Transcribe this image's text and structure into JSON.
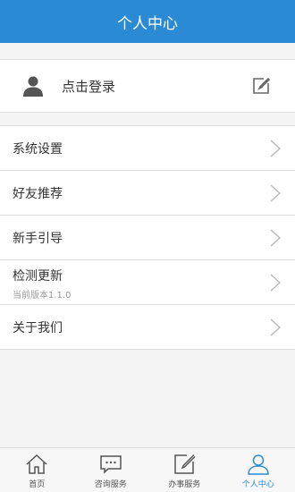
{
  "header": {
    "title": "个人中心"
  },
  "login": {
    "label": "点击登录",
    "icon": "user-icon",
    "edit_icon": "edit-icon"
  },
  "menu": [
    {
      "label": "系统设置",
      "sub": ""
    },
    {
      "label": "好友推荐",
      "sub": ""
    },
    {
      "label": "新手引导",
      "sub": ""
    },
    {
      "label": "检测更新",
      "sub": "当前版本1.1.0"
    },
    {
      "label": "关于我们",
      "sub": ""
    }
  ],
  "tabs": [
    {
      "label": "首页",
      "icon": "home-icon",
      "active": false
    },
    {
      "label": "咨询服务",
      "icon": "chat-icon",
      "active": false
    },
    {
      "label": "办事服务",
      "icon": "edit-icon",
      "active": false
    },
    {
      "label": "个人中心",
      "icon": "person-icon",
      "active": true
    }
  ],
  "colors": {
    "accent": "#2a8ad4",
    "background": "#f4f4f4",
    "divider": "#dedede"
  }
}
